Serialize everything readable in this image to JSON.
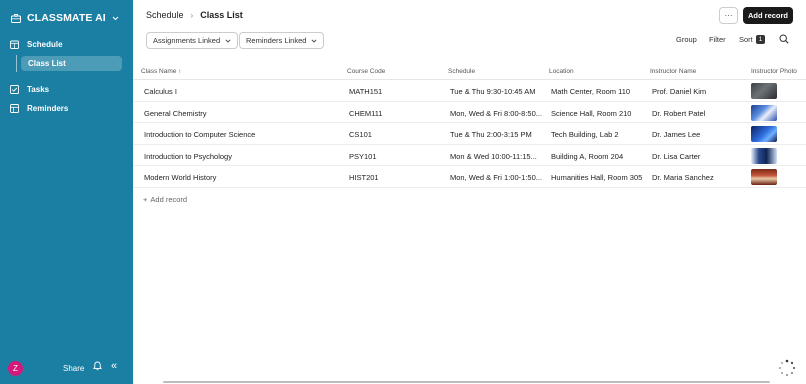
{
  "app": {
    "name": "CLASSMATE AI"
  },
  "sidebar": {
    "items": [
      {
        "label": "Schedule",
        "icon": "calendar-icon"
      },
      {
        "label": "Class List"
      },
      {
        "label": "Tasks",
        "icon": "checkbox-icon"
      },
      {
        "label": "Reminders",
        "icon": "table-icon"
      }
    ],
    "footer": {
      "avatar_initial": "Z",
      "share_label": "Share"
    }
  },
  "header": {
    "breadcrumb": [
      "Schedule",
      "Class List"
    ],
    "more_label": "···",
    "add_button": "Add record"
  },
  "filters": {
    "chips": [
      "Assignments Linked",
      "Reminders Linked"
    ],
    "group_label": "Group",
    "filter_label": "Filter",
    "sort_label": "Sort",
    "sort_count": "1"
  },
  "table": {
    "columns": [
      "Class Name ↑",
      "Course Code",
      "Schedule",
      "Location",
      "Instructor Name",
      "Instructor Photo"
    ],
    "rows": [
      {
        "name": "Calculus I",
        "code": "MATH151",
        "schedule": "Tue & Thu 9:30-10:45 AM",
        "location": "Math Center, Room 110",
        "instructor": "Prof. Daniel Kim"
      },
      {
        "name": "General Chemistry",
        "code": "CHEM111",
        "schedule": "Mon, Wed & Fri 8:00-8:50...",
        "location": "Science Hall, Room 210",
        "instructor": "Dr. Robert Patel"
      },
      {
        "name": "Introduction to Computer Science",
        "code": "CS101",
        "schedule": "Tue & Thu 2:00-3:15 PM",
        "location": "Tech Building, Lab 2",
        "instructor": "Dr. James Lee"
      },
      {
        "name": "Introduction to Psychology",
        "code": "PSY101",
        "schedule": "Mon & Wed 10:00-11:15...",
        "location": "Building A, Room 204",
        "instructor": "Dr. Lisa Carter"
      },
      {
        "name": "Modern World History",
        "code": "HIST201",
        "schedule": "Mon, Wed & Fri 1:00-1:50...",
        "location": "Humanities Hall, Room 305",
        "instructor": "Dr. Maria Sanchez"
      }
    ],
    "add_record_label": "Add record"
  },
  "colors": {
    "sidebar": "#1a7fa3",
    "avatar": "#d5197a",
    "primary_button": "#1a1a1a"
  }
}
